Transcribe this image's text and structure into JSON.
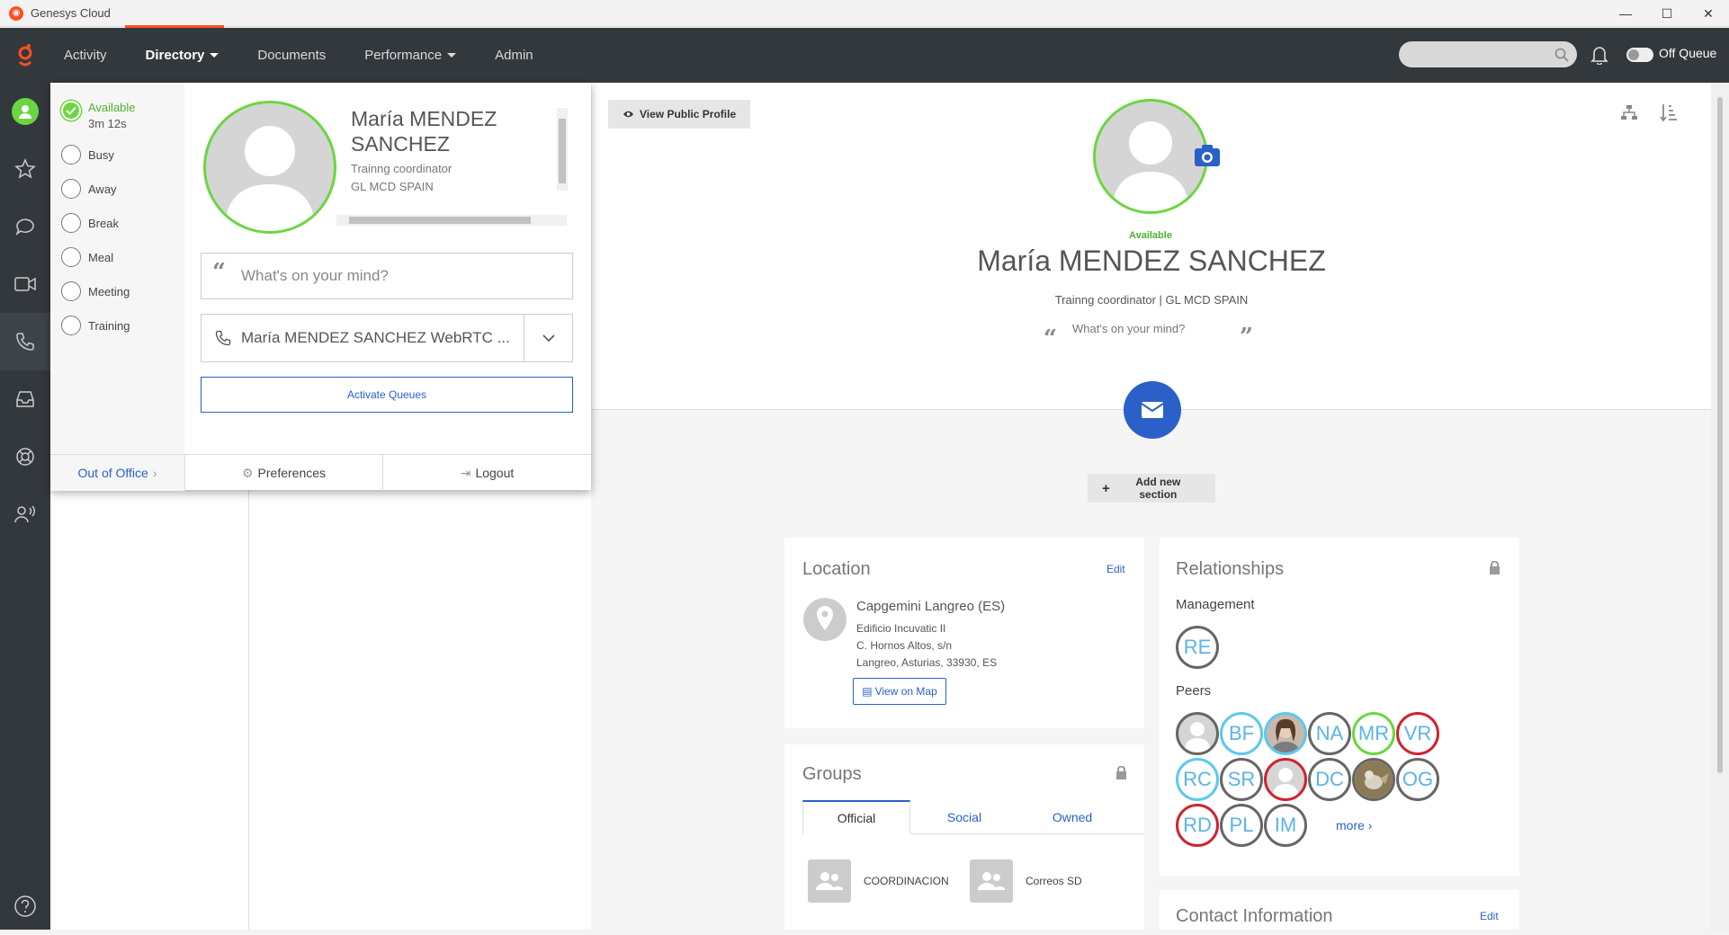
{
  "window": {
    "title": "Genesys Cloud",
    "minimize": "—",
    "maximize": "☐",
    "close": "✕"
  },
  "nav": {
    "activity": "Activity",
    "directory": "Directory",
    "documents": "Documents",
    "performance": "Performance",
    "admin": "Admin",
    "search_placeholder": "",
    "queue_toggle": "Off Queue"
  },
  "status_menu": {
    "current": {
      "label": "Available",
      "duration": "3m 12s"
    },
    "options": [
      "Busy",
      "Away",
      "Break",
      "Meal",
      "Meeting",
      "Training"
    ],
    "out_of_office": "Out of Office"
  },
  "popup": {
    "name": "María MENDEZ SANCHEZ",
    "title": "Trainng coordinator",
    "department": "GL MCD SPAIN",
    "mind_placeholder": "What's on your mind?",
    "phone": "María MENDEZ SANCHEZ WebRTC ...",
    "activate_queues": "Activate Queues",
    "preferences": "Preferences",
    "logout": "Logout"
  },
  "profile": {
    "view_public": "View Public Profile",
    "status": "Available",
    "name": "María MENDEZ SANCHEZ",
    "subtitle": "Trainng coordinator | GL MCD SPAIN",
    "mind": "What's on your mind?",
    "add_section": "Add new section"
  },
  "location": {
    "title": "Location",
    "edit": "Edit",
    "place": "Capgemini Langreo (ES)",
    "line1": "Edificio Incuvatic II",
    "line2": "C. Hornos Altos, s/n",
    "line3": "Langreo, Asturias, 33930, ES",
    "view_map": "View on Map"
  },
  "groups": {
    "title": "Groups",
    "tabs": [
      "Official",
      "Social",
      "Owned"
    ],
    "items": [
      "COORDINACION",
      "Correos SD"
    ]
  },
  "relationships": {
    "title": "Relationships",
    "management_label": "Management",
    "management": [
      "RE"
    ],
    "peers_label": "Peers",
    "peers": [
      "BF",
      "NA",
      "MR",
      "VR",
      "RC",
      "SR",
      "DC",
      "OG",
      "RD",
      "PL",
      "IM"
    ],
    "more": "more ›"
  },
  "contact": {
    "title": "Contact Information",
    "edit": "Edit"
  },
  "colors": {
    "nav_bg": "#33383d",
    "accent": "#ff4f1f",
    "available": "#6bd641",
    "link": "#2a60c8",
    "busy": "#d0232f",
    "offline": "#666666",
    "away": "#5bc9f0"
  }
}
